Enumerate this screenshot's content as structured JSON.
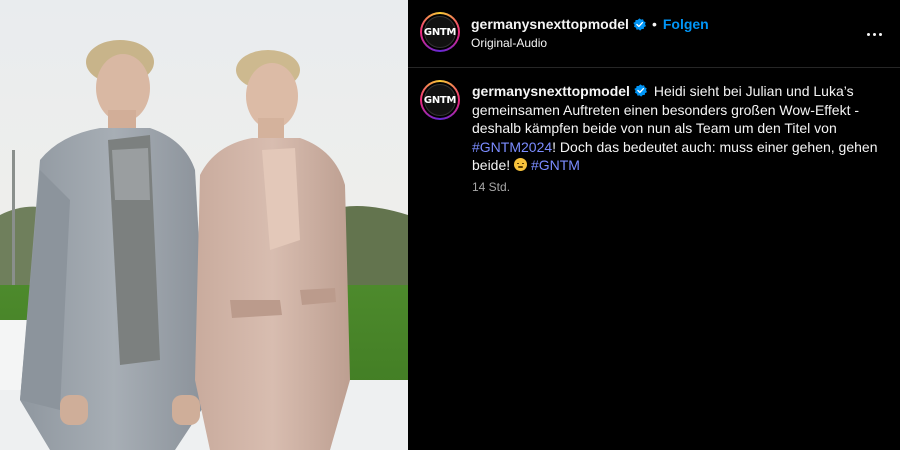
{
  "post": {
    "account": {
      "username": "germanysnexttopmodel",
      "avatar_text": "GNTM",
      "verified": true
    },
    "header": {
      "separator": "•",
      "follow_label": "Folgen",
      "audio_label": "Original-Audio",
      "more_icon": "more-horizontal-icon"
    },
    "caption": {
      "text_part1": "Heidi sieht bei Julian und Luka’s gemeinsamen Auftreten einen besonders großen Wow-Effekt - deshalb kämpfen beide von nun als Team um den Titel von ",
      "hashtag1": "#GNTM2024",
      "text_part2": "! Doch das bedeutet auch: muss einer gehen, gehen beide! ",
      "emoji": "grimacing-face-emoji",
      "hashtag2": "#GNTM"
    },
    "timestamp": "14 Std."
  },
  "colors": {
    "background": "#000000",
    "link_blue": "#0095f6",
    "hashtag": "#7b8cff",
    "muted_text": "#a8a8a8",
    "verified_badge": "#0095f6"
  }
}
